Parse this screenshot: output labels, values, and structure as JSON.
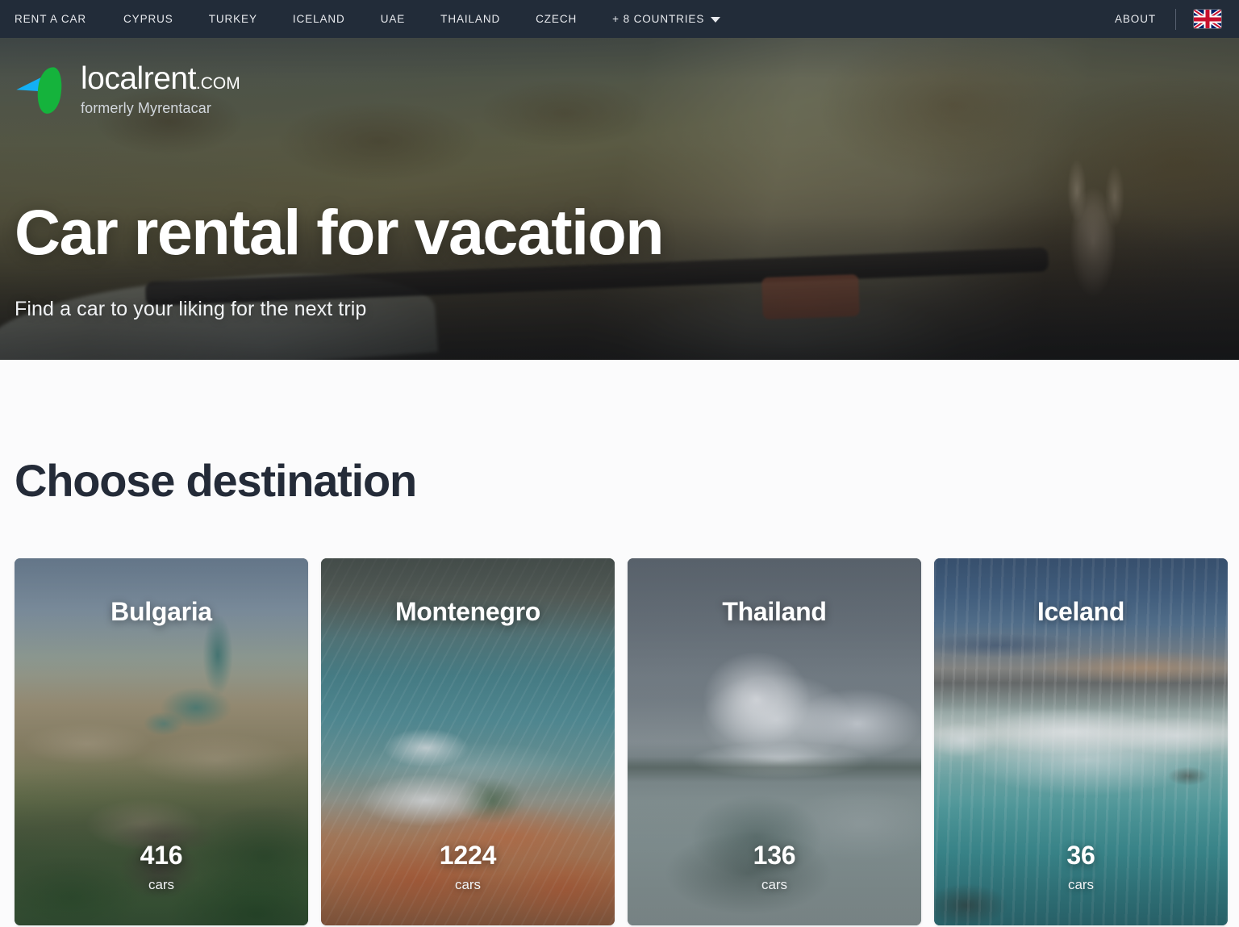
{
  "nav": {
    "items": [
      {
        "label": "RENT A CAR"
      },
      {
        "label": "CYPRUS"
      },
      {
        "label": "TURKEY"
      },
      {
        "label": "ICELAND"
      },
      {
        "label": "UAE"
      },
      {
        "label": "THAILAND"
      },
      {
        "label": "CZECH"
      }
    ],
    "more_countries_label": "+ 8 COUNTRIES",
    "about_label": "ABOUT",
    "language_flag": "uk-flag-icon",
    "background_color": "#222c39"
  },
  "logo": {
    "name": "localrent",
    "tld": ".COM",
    "tagline": "formerly Myrentacar",
    "mark_blue": "#13b0f5",
    "mark_green": "#15b33c"
  },
  "hero": {
    "title": "Car rental for vacation",
    "subtitle": "Find a car to your liking for the next trip"
  },
  "main": {
    "section_title": "Choose destination",
    "destinations": [
      {
        "name": "Bulgaria",
        "count": "416",
        "unit": "cars"
      },
      {
        "name": "Montenegro",
        "count": "1224",
        "unit": "cars"
      },
      {
        "name": "Thailand",
        "count": "136",
        "unit": "cars"
      },
      {
        "name": "Iceland",
        "count": "36",
        "unit": "cars"
      }
    ]
  }
}
